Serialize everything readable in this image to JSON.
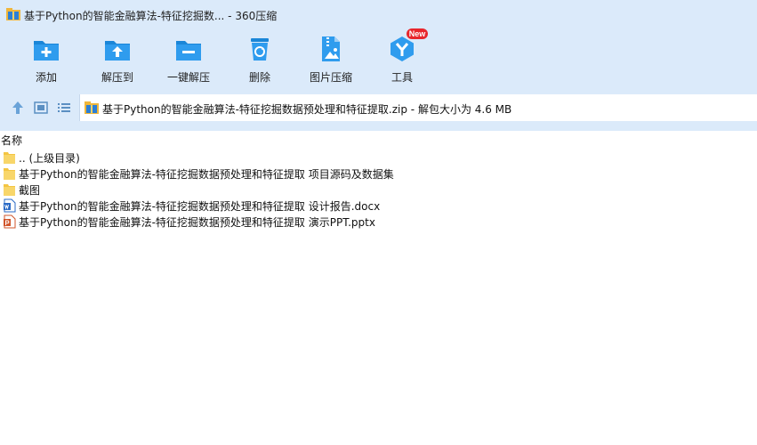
{
  "window": {
    "title": "基于Python的智能金融算法-特征挖掘数... - 360压缩"
  },
  "toolbar": {
    "buttons": [
      {
        "label": "添加",
        "icon": "add-icon"
      },
      {
        "label": "解压到",
        "icon": "extract-to-icon"
      },
      {
        "label": "一键解压",
        "icon": "one-click-extract-icon"
      },
      {
        "label": "删除",
        "icon": "trash-icon"
      },
      {
        "label": "图片压缩",
        "icon": "image-compress-icon"
      },
      {
        "label": "工具",
        "icon": "tools-icon"
      }
    ],
    "tools_badge": "New"
  },
  "navigation": {
    "up_icon": "up-arrow-icon",
    "thumbnail_view_icon": "thumbnail-view-icon",
    "list_view_icon": "list-view-icon",
    "address": "基于Python的智能金融算法-特征挖掘数据预处理和特征提取.zip - 解包大小为 4.6 MB"
  },
  "list": {
    "column_name": "名称",
    "items": [
      {
        "name": ".. (上级目录)",
        "icon": "folder-icon"
      },
      {
        "name": "基于Python的智能金融算法-特征挖掘数据预处理和特征提取 项目源码及数据集",
        "icon": "folder-icon"
      },
      {
        "name": "截图",
        "icon": "folder-icon"
      },
      {
        "name": "基于Python的智能金融算法-特征挖掘数据预处理和特征提取 设计报告.docx",
        "icon": "word-doc-icon"
      },
      {
        "name": "基于Python的智能金融算法-特征挖掘数据预处理和特征提取 演示PPT.pptx",
        "icon": "powerpoint-icon"
      }
    ]
  },
  "colors": {
    "chrome_background": "#dbeafa",
    "icon_blue": "#1d8fe0",
    "badge_red": "#e8262c",
    "folder_yellow": "#f4c542"
  }
}
